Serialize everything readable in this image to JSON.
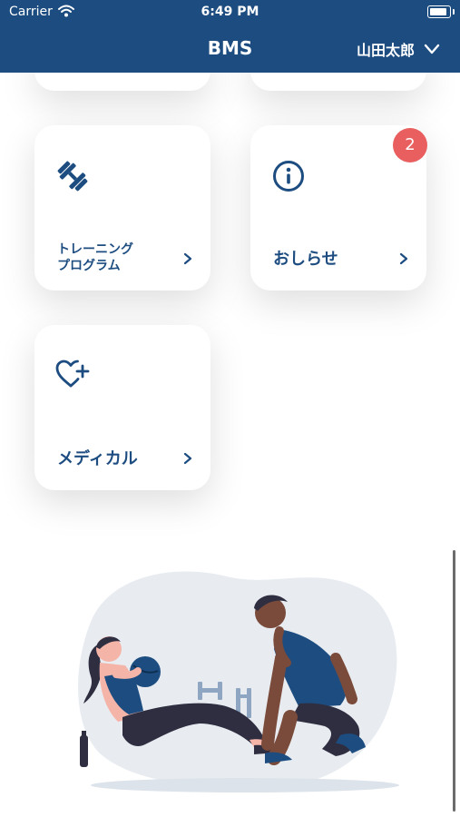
{
  "status_bar": {
    "carrier": "Carrier",
    "time": "6:49 PM"
  },
  "nav": {
    "title": "BMS",
    "user_name": "山田太郎"
  },
  "cards": {
    "training": {
      "line1": "トレーニング",
      "line2": "プログラム"
    },
    "notices": {
      "label": "おしらせ",
      "badge": "2"
    },
    "medical": {
      "label": "メディカル"
    }
  },
  "colors": {
    "header": "#1d4d80",
    "accent": "#1d4d80",
    "badge": "#e95f5f"
  },
  "icons": [
    "wifi-icon",
    "battery-icon",
    "chevron-down-icon",
    "dumbbell-icon",
    "info-icon",
    "heart-plus-icon",
    "chevron-right-icon"
  ]
}
